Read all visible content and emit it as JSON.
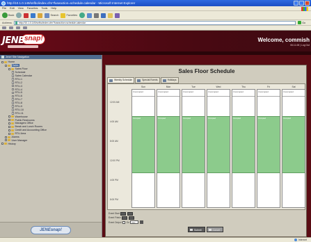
{
  "window": {
    "title": "http://10.1.0.149/snfbo/index.cfm?fuseaction=schedule.calendar - Microsoft Internet Explorer",
    "menu": [
      "File",
      "Edit",
      "View",
      "Favorites",
      "Tools",
      "Help"
    ]
  },
  "toolbar": {
    "back": "Back",
    "search": "Search",
    "favorites": "Favorites"
  },
  "address": {
    "label": "Address",
    "url": "http://10.1.0.149/snfbo/index.cfm?fuseaction=schedule.calendar",
    "go": "Go"
  },
  "header": {
    "logo_text": "JENE",
    "logo_snap": "snap!",
    "welcome": "Welcome, commish",
    "welcome_sub": "06.11.08 | Log Out"
  },
  "sidebar": {
    "title": "Jene! Site Navigation",
    "items": [
      {
        "label": "Home",
        "level": 0,
        "kind": "folder"
      },
      {
        "label": "Sales",
        "level": 1,
        "kind": "folder",
        "selected": true
      },
      {
        "label": "Sales Floor",
        "level": 2,
        "kind": "folder"
      },
      {
        "label": "Schedule",
        "level": 3,
        "kind": "doc"
      },
      {
        "label": "Sales Calendar",
        "level": 3,
        "kind": "doc"
      },
      {
        "label": "RTU-1",
        "level": 3,
        "kind": "doc"
      },
      {
        "label": "RTU-2",
        "level": 3,
        "kind": "doc"
      },
      {
        "label": "RTU-3",
        "level": 3,
        "kind": "doc"
      },
      {
        "label": "RTU-4",
        "level": 3,
        "kind": "doc"
      },
      {
        "label": "RTU-5",
        "level": 3,
        "kind": "doc"
      },
      {
        "label": "RTU-6",
        "level": 3,
        "kind": "doc"
      },
      {
        "label": "RTU-7",
        "level": 3,
        "kind": "doc"
      },
      {
        "label": "RTU-8",
        "level": 3,
        "kind": "doc"
      },
      {
        "label": "RTU-9",
        "level": 3,
        "kind": "doc"
      },
      {
        "label": "RTU-10",
        "level": 3,
        "kind": "doc"
      },
      {
        "label": "RTU-11",
        "level": 3,
        "kind": "doc"
      },
      {
        "label": "Warehouse",
        "level": 2,
        "kind": "folder"
      },
      {
        "label": "Public Restrooms",
        "level": 2,
        "kind": "folder"
      },
      {
        "label": "Managers Office",
        "level": 2,
        "kind": "folder"
      },
      {
        "label": "Break and Lunch Rooms",
        "level": 2,
        "kind": "folder"
      },
      {
        "label": "Credit and Accounting Office",
        "level": 2,
        "kind": "folder"
      },
      {
        "label": "RTU Area",
        "level": 2,
        "kind": "folder"
      },
      {
        "label": "Alarms",
        "level": 1,
        "kind": "folder"
      },
      {
        "label": "User Manager",
        "level": 1,
        "kind": "folder"
      },
      {
        "label": "History",
        "level": 0,
        "kind": "folder"
      }
    ],
    "footer_logo": "JENEsnap!"
  },
  "main": {
    "title": "Sales Floor Schedule",
    "tabs": [
      {
        "label": "Weekly Schedule"
      },
      {
        "label": "Special Events"
      },
      {
        "label": "Holidays"
      }
    ],
    "days": [
      {
        "name": "Sun",
        "head": "Unoccupied",
        "shift": "Occupied"
      },
      {
        "name": "Mon",
        "head": "Unoccupied",
        "shift": "Occupied"
      },
      {
        "name": "Tue",
        "head": "Unoccupied",
        "shift": "Occupied"
      },
      {
        "name": "Wed",
        "head": "Unoccupied",
        "shift": "Occupied"
      },
      {
        "name": "Thu",
        "head": "Unoccupied",
        "shift": "Occupied"
      },
      {
        "name": "Fri",
        "head": "Unoccupied",
        "shift": "Occupied"
      },
      {
        "name": "Sat",
        "head": "Unoccupied",
        "shift": "Occupied"
      }
    ],
    "times": [
      "12:00 AM",
      "4:00 AM",
      "8:00 AM",
      "12:00 PM",
      "4:00 PM",
      "8:00 PM",
      "11:59 PM"
    ],
    "controls": {
      "event_start_label": "Event Start",
      "event_finish_label": "Event Finish",
      "event_output_label": "Event Output",
      "output_checkbox_label": "On",
      "output_select": "Occ"
    },
    "buttons": {
      "submit": "Submit",
      "cancel": "Cancel"
    }
  },
  "status": {
    "zone": "Internet"
  },
  "colors": {
    "header_bg": "#5a0c14",
    "shift_green": "#8ccb8c",
    "sidebar_bg": "#c9c5b8"
  }
}
